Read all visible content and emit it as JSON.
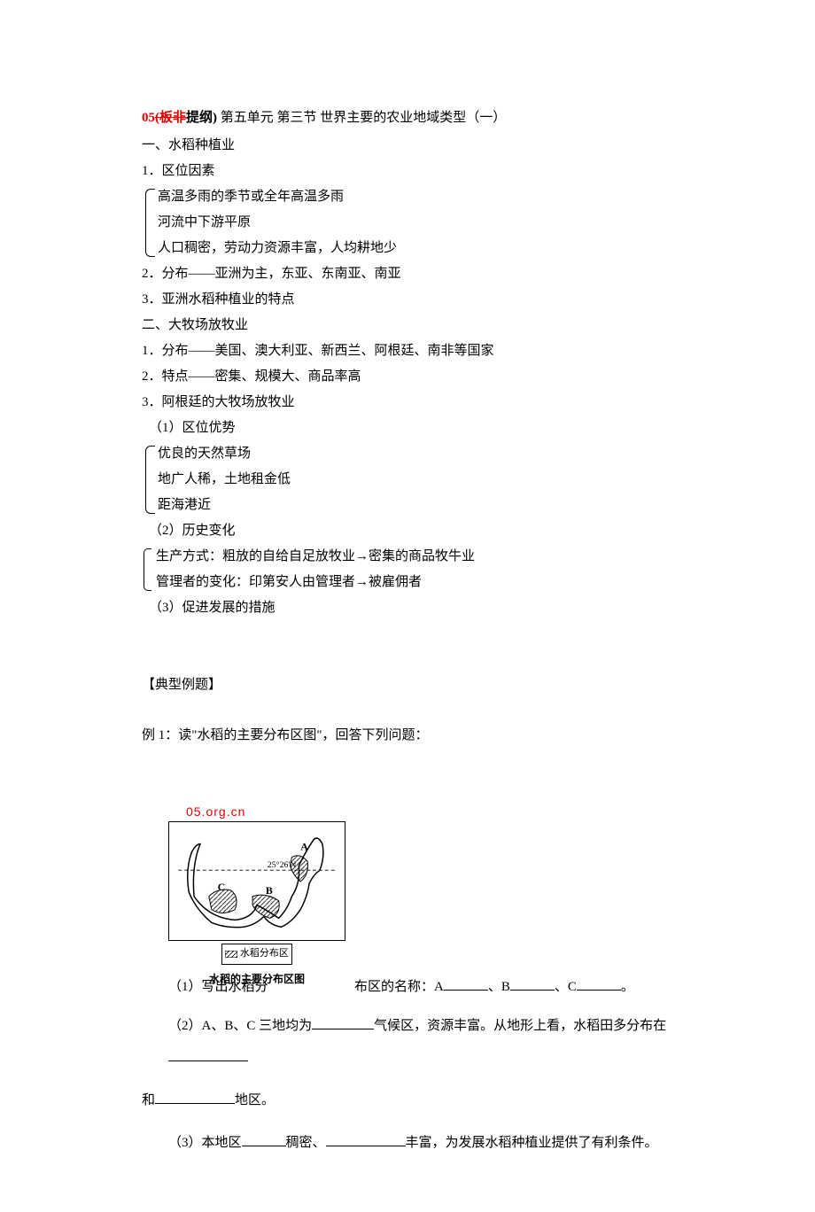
{
  "header": {
    "prefix": "05",
    "strike": "(板非",
    "bold_part": "提纲)",
    "title": " 第五单元 第三节 世界主要的农业地域类型（一）"
  },
  "outline": {
    "sec1_title": "一、水稻种植业",
    "sec1_1": "1．区位因素",
    "sec1_1_items": [
      "高温多雨的季节或全年高温多雨",
      "河流中下游平原",
      "人口稠密，劳动力资源丰富，人均耕地少"
    ],
    "sec1_2": "2．分布——亚洲为主，东亚、东南亚、南亚",
    "sec1_3": "3．亚洲水稻种植业的特点",
    "sec2_title": "二、大牧场放牧业",
    "sec2_1": "1．分布——美国、澳大利亚、新西兰、阿根廷、南非等国家",
    "sec2_2": "2．特点——密集、规模大、商品率高",
    "sec2_3": "3．阿根廷的大牧场放牧业",
    "sec2_3_1": "（1）区位优势",
    "sec2_3_1_items": [
      "优良的天然草场",
      "地广人稀，土地租金低",
      "距海港近"
    ],
    "sec2_3_2": "（2）历史变化",
    "sec2_3_2_items": [
      "生产方式：粗放的自给自足放牧业→密集的商品牧牛业",
      "管理者的变化：印第安人由管理者→被雇佣者"
    ],
    "sec2_3_3": "（3）促进发展的措施"
  },
  "examples": {
    "section_label": "【典型例题】",
    "ex1_title": "例 1：读\"水稻的主要分布区图\"，回答下列问题：",
    "map_watermark": "05.org.cn",
    "map_lat_label": "25°26'N",
    "map_legend_label": "水稻分布区",
    "map_caption": "水稻的主要分布区图",
    "q1_left": "（1）写出水稻分",
    "q1_right_a": "布区的名称：A",
    "q1_right_b": "、B",
    "q1_right_c": "、C",
    "q1_right_end": "。",
    "q2_a": "（2）A、B、C 三地均为",
    "q2_b": "气候区，资源丰富。从地形上看，水稻田多分布在",
    "q2_line2_a": "和",
    "q2_line2_b": "地区。",
    "q3_a": "（3）本地区",
    "q3_b": "稠密、",
    "q3_c": "丰富，为发展水稻种植业提供了有利条件。"
  }
}
